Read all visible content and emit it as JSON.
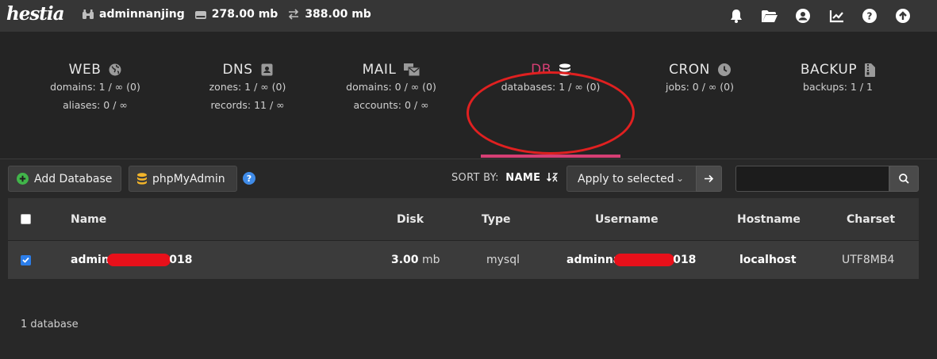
{
  "app": {
    "logo_text": "hestia",
    "user": "adminnanjing",
    "disk": "278.00 mb",
    "bandwidth": "388.00 mb",
    "top_icons": [
      "bell-icon",
      "folder-open-icon",
      "user-circle-icon",
      "chart-line-icon",
      "question-circle-icon",
      "arrow-up-circle-icon"
    ]
  },
  "tabs": [
    {
      "label": "WEB",
      "icon": "globe-icon",
      "stats": [
        "domains: 1 / ∞ (0)",
        "aliases: 0 / ∞"
      ]
    },
    {
      "label": "DNS",
      "icon": "address-book-icon",
      "stats": [
        "zones: 1 / ∞ (0)",
        "records: 11 / ∞"
      ]
    },
    {
      "label": "MAIL",
      "icon": "mail-bulk-icon",
      "stats": [
        "domains: 0 / ∞ (0)",
        "accounts: 0 / ∞"
      ]
    },
    {
      "label": "DB",
      "icon": "database-icon",
      "stats": [
        "databases: 1 / ∞ (0)"
      ],
      "active": true
    },
    {
      "label": "CRON",
      "icon": "clock-icon",
      "stats": [
        "jobs: 0 / ∞ (0)"
      ]
    },
    {
      "label": "BACKUP",
      "icon": "file-archive-icon",
      "stats": [
        "backups: 1 / 1"
      ]
    }
  ],
  "toolbar": {
    "add_database": "Add Database",
    "phpmyadmin": "phpMyAdmin",
    "help": "?",
    "sort_by_label": "SORT BY:",
    "sort_by_value": "NAME",
    "bulk_select": "Apply to selected",
    "search_value": "",
    "search_placeholder": ""
  },
  "table": {
    "columns": [
      "Name",
      "Disk",
      "Type",
      "Username",
      "Hostname",
      "Charset"
    ],
    "rows": [
      {
        "checked": true,
        "name_prefix": "adminna",
        "name_suffix": "018",
        "disk_value": "3.00",
        "disk_unit": "mb",
        "type": "mysql",
        "username_prefix": "adminnan",
        "username_suffix": "018",
        "hostname": "localhost",
        "charset": "UTF8MB4"
      }
    ]
  },
  "footer": {
    "count": "1 database"
  },
  "colors": {
    "accent": "#d63f74",
    "annotation": "#e02020",
    "checkbox": "#2b7de9"
  }
}
